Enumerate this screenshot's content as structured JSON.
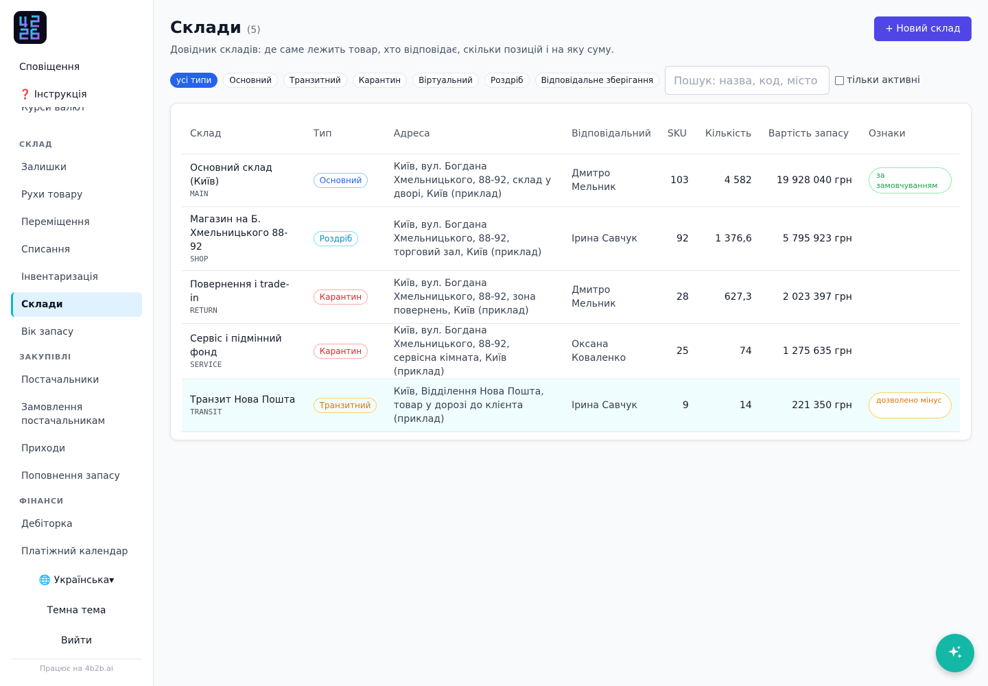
{
  "brand": {
    "logo_text": "4B2B",
    "powered_by": "Працює на 4b2b.ai"
  },
  "sidebar": {
    "top_items": [
      {
        "label": "Сповіщення"
      },
      {
        "label": "❓ Інструкція"
      },
      {
        "label": "Курси валют"
      }
    ],
    "sections": [
      {
        "title": "СКЛАД",
        "items": [
          "Залишки",
          "Рухи товару",
          "Переміщення",
          "Списання",
          "Інвентаризація",
          "Склади",
          "Вік запасу"
        ]
      },
      {
        "title": "ЗАКУПІВЛІ",
        "items": [
          "Постачальники",
          "Замовлення постачальникам",
          "Приходи",
          "Поповнення запасу"
        ]
      },
      {
        "title": "ФІНАНСИ",
        "items": [
          "Дебіторка",
          "Платіжний календар"
        ]
      }
    ],
    "active_item": "Склади",
    "language": "🌐 Українська▾",
    "theme": "Темна тема",
    "logout": "Вийти"
  },
  "header": {
    "title": "Склади",
    "count": "(5)",
    "subtitle": "Довідник складів: де саме лежить товар, хто відповідає, скільки позицій і на яку суму.",
    "new_button": "+ Новий склад"
  },
  "filters": {
    "chips": [
      "усі типи",
      "Основний",
      "Транзитний",
      "Карантин",
      "Віртуальний",
      "Роздріб",
      "Відповідальне зберігання"
    ],
    "active_chip": "усі типи",
    "search_placeholder": "Пошук: назва, код, місто",
    "search_value": "",
    "active_only_label": "тільки активні",
    "active_only_checked": false
  },
  "table": {
    "columns": [
      "Склад",
      "Тип",
      "Адреса",
      "Відповідальний",
      "SKU",
      "Кількість",
      "Вартість запасу",
      "Ознаки"
    ],
    "rows": [
      {
        "name": "Основний склад (Київ)",
        "code": "MAIN",
        "type": "Основний",
        "address": "Київ, вул. Богдана Хмельницького, 88-92, склад у дворі, Київ (приклад)",
        "manager": "Дмитро Мельник",
        "sku": "103",
        "qty": "4 582",
        "value": "19 928 040 грн",
        "flag": "за замовчуванням"
      },
      {
        "name": "Магазин на Б. Хмельницького 88-92",
        "code": "SHOP",
        "type": "Роздріб",
        "address": "Київ, вул. Богдана Хмельницького, 88-92, торговий зал, Київ (приклад)",
        "manager": "Ірина Савчук",
        "sku": "92",
        "qty": "1 376,6",
        "value": "5 795 923 грн",
        "flag": ""
      },
      {
        "name": "Повернення і trade-in",
        "code": "RETURN",
        "type": "Карантин",
        "address": "Київ, вул. Богдана Хмельницького, 88-92, зона повернень, Київ (приклад)",
        "manager": "Дмитро Мельник",
        "sku": "28",
        "qty": "627,3",
        "value": "2 023 397 грн",
        "flag": ""
      },
      {
        "name": "Сервіс і підмінний фонд",
        "code": "SERVICE",
        "type": "Карантин",
        "address": "Київ, вул. Богдана Хмельницького, 88-92, сервісна кімната, Київ (приклад)",
        "manager": "Оксана Коваленко",
        "sku": "25",
        "qty": "74",
        "value": "1 275 635 грн",
        "flag": ""
      },
      {
        "name": "Транзит Нова Пошта",
        "code": "TRANSIT",
        "type": "Транзитний",
        "address": "Київ, Відділення Нова Пошта, товар у дорозі до клієнта (приклад)",
        "manager": "Ірина Савчук",
        "sku": "9",
        "qty": "14",
        "value": "221 350 грн",
        "flag": "дозволено мінус"
      }
    ]
  },
  "colors": {
    "accent": "#4f46e5",
    "chip_active": "#2563eb",
    "fab": "#14b8a6",
    "active_nav_bg": "#e0f2fe"
  },
  "fab": {
    "icon": "sparkles-icon"
  }
}
